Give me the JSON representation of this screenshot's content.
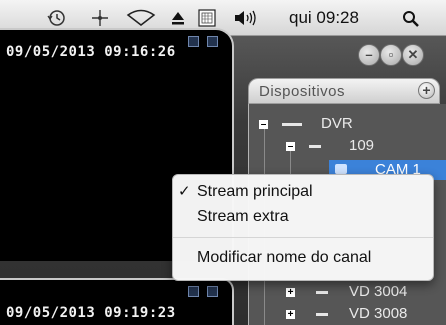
{
  "menubar": {
    "clock": "qui 09:28",
    "icons": [
      "time-machine-icon",
      "bluetooth-icon",
      "wifi-icon",
      "eject-icon",
      "keyboard-layout-icon",
      "volume-icon",
      "spotlight-icon"
    ]
  },
  "window": {
    "controls": [
      "minimize",
      "zoom",
      "close"
    ]
  },
  "panes": [
    {
      "timestamp": "09/05/2013 09:16:26"
    },
    {
      "timestamp": "09/05/2013 09:19:23"
    }
  ],
  "devices": {
    "title": "Dispositivos",
    "add_label": "+",
    "tree": {
      "root": "DVR",
      "node": "109",
      "selected": "CAM 1",
      "vd1": "VD 3004",
      "vd2": "VD 3008"
    }
  },
  "context_menu": {
    "items": [
      {
        "label": "Stream principal",
        "checked": true
      },
      {
        "label": "Stream extra",
        "checked": false
      },
      {
        "label": "Modificar nome do canal",
        "checked": false
      }
    ],
    "check_glyph": "✓"
  },
  "colors": {
    "selection": "#3b82d9",
    "pane_bg": "#000000"
  }
}
